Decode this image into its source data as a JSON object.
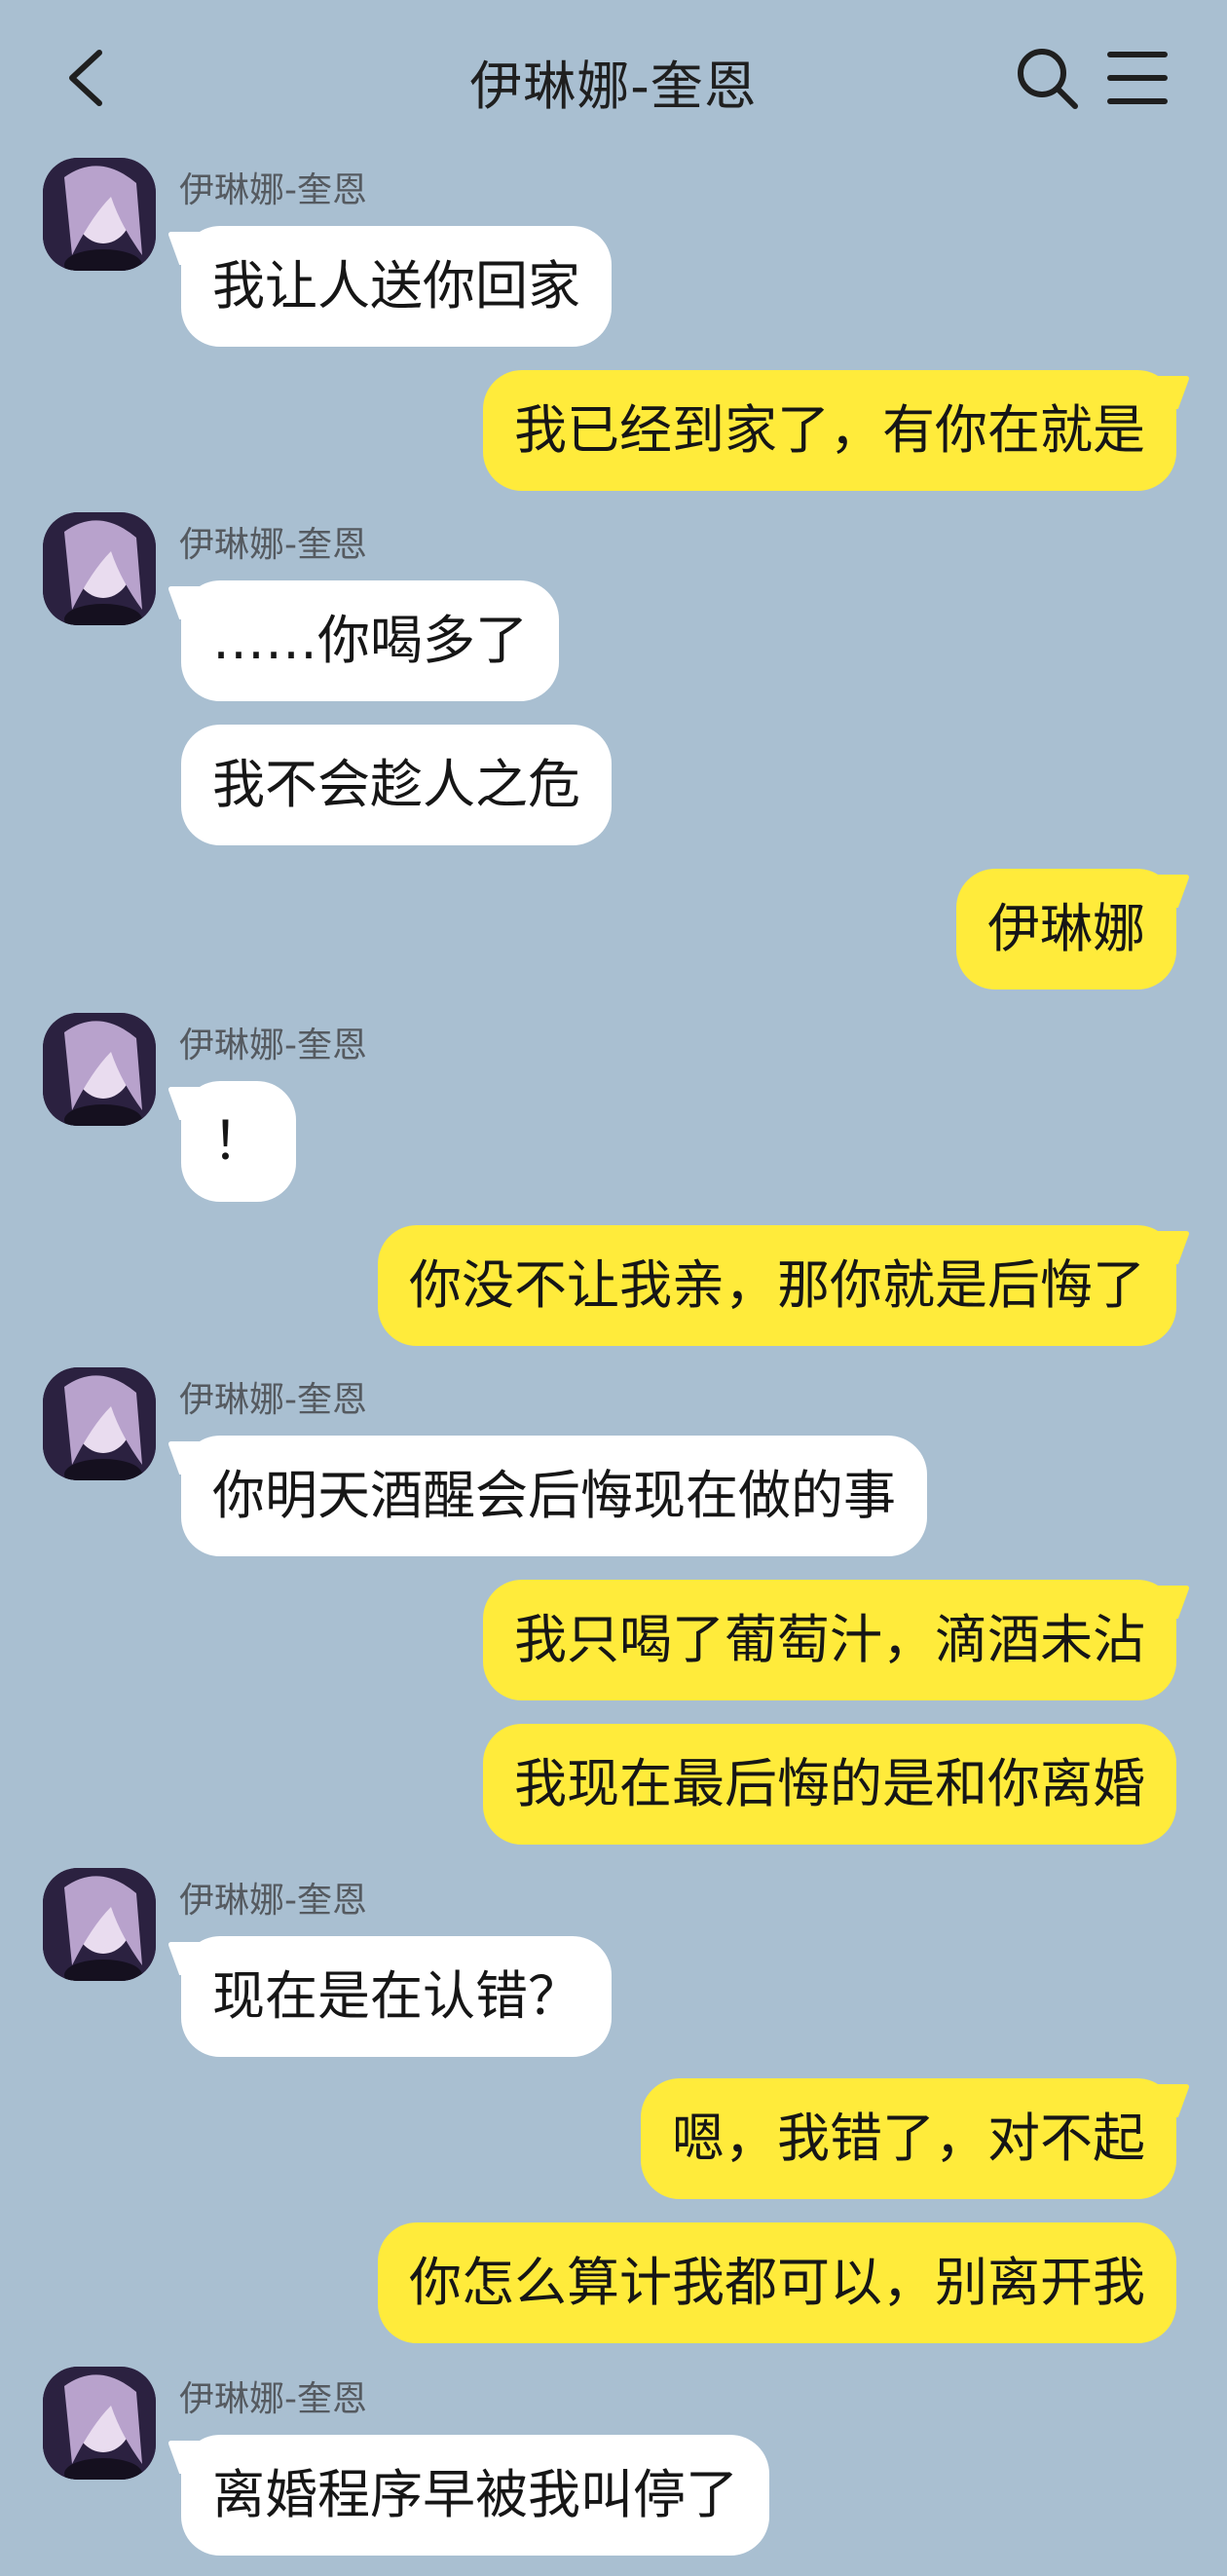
{
  "header": {
    "title": "伊琳娜-奎恩",
    "back_icon": "chevron-left-icon",
    "search_icon": "search-icon",
    "menu_icon": "menu-icon"
  },
  "colors": {
    "background": "#a9bfd1",
    "incoming_bubble": "#ffffff",
    "outgoing_bubble": "#ffeb3b"
  },
  "messages": [
    {
      "sender": "伊琳娜-奎恩",
      "text": "我让人送你回家"
    },
    {
      "text": "我已经到家了，有你在就是"
    },
    {
      "sender": "伊琳娜-奎恩",
      "text": "……你喝多了"
    },
    {
      "text": "我不会趁人之危"
    },
    {
      "text": "伊琳娜"
    },
    {
      "sender": "伊琳娜-奎恩",
      "text": "！"
    },
    {
      "text": "你没不让我亲，那你就是后悔了"
    },
    {
      "sender": "伊琳娜-奎恩",
      "text": "你明天酒醒会后悔现在做的事"
    },
    {
      "text": "我只喝了葡萄汁，滴酒未沾"
    },
    {
      "text": "我现在最后悔的是和你离婚"
    },
    {
      "sender": "伊琳娜-奎恩",
      "text": "现在是在认错？"
    },
    {
      "text": "嗯，我错了，对不起"
    },
    {
      "text": "你怎么算计我都可以，别离开我"
    },
    {
      "sender": "伊琳娜-奎恩",
      "text": "离婚程序早被我叫停了"
    }
  ]
}
